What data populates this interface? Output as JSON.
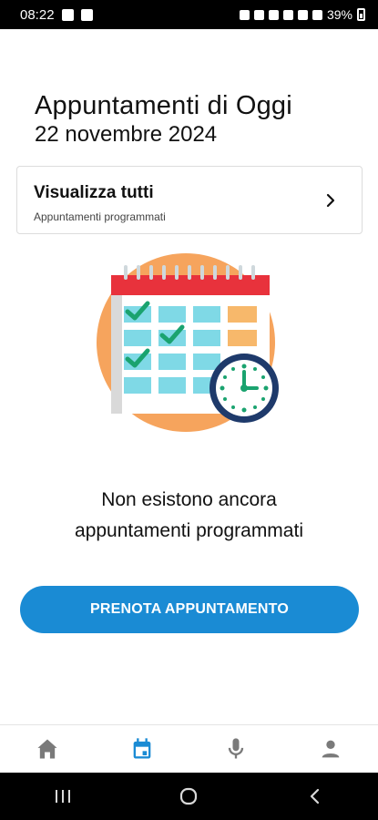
{
  "status_bar": {
    "time": "08:22",
    "battery": "39%"
  },
  "header": {
    "title": "Appuntamenti di Oggi",
    "date": "22 novembre 2024"
  },
  "view_all": {
    "title": "Visualizza tutti",
    "subtitle": "Appuntamenti programmati",
    "icon": "chevron-right-icon"
  },
  "illustration": {
    "icon": "calendar-clock-illustration",
    "colors": {
      "circle": "#f6a45d",
      "calendar_top": "#e8323c",
      "cells": "#7fd9e6",
      "check": "#1aa36f",
      "clock_ring": "#1e3a6b"
    }
  },
  "empty_state": {
    "line1": "Non esistono ancora",
    "line2": "appuntamenti programmati"
  },
  "cta": {
    "label": "PRENOTA APPUNTAMENTO",
    "color": "#1a8bd4"
  },
  "bottom_nav": {
    "items": [
      {
        "icon": "home-icon",
        "active": false
      },
      {
        "icon": "calendar-icon",
        "active": true
      },
      {
        "icon": "microphone-icon",
        "active": false
      },
      {
        "icon": "person-icon",
        "active": false
      }
    ],
    "active_color": "#1a8bd4",
    "inactive_color": "#7a7a7a"
  },
  "system_nav": {
    "buttons": [
      "recents-icon",
      "home-circle-icon",
      "back-icon"
    ]
  }
}
